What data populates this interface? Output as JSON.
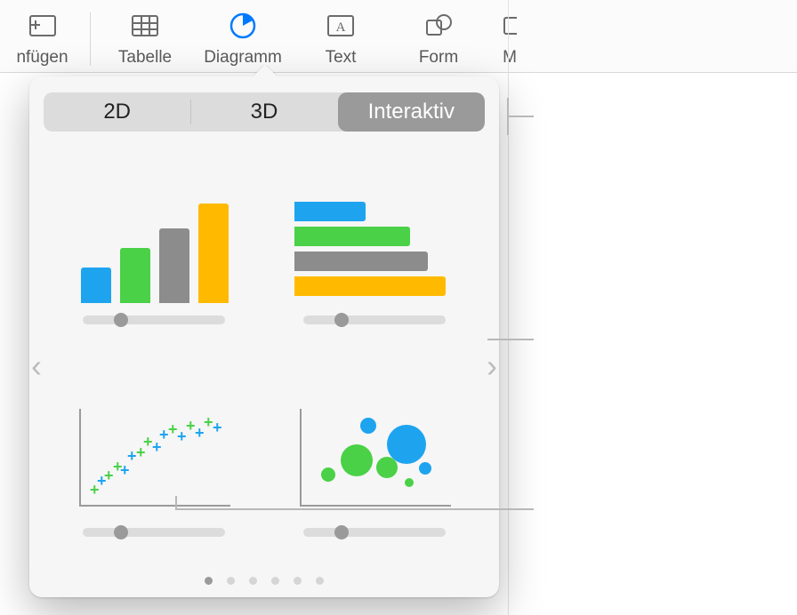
{
  "toolbar": {
    "items": [
      {
        "label": "nfügen",
        "icon": "insert"
      },
      {
        "label": "Tabelle",
        "icon": "table"
      },
      {
        "label": "Diagramm",
        "icon": "chart",
        "active": true
      },
      {
        "label": "Text",
        "icon": "text"
      },
      {
        "label": "Form",
        "icon": "shape"
      },
      {
        "label": "M",
        "icon": "more"
      }
    ]
  },
  "popover": {
    "segments": {
      "two_d": "2D",
      "three_d": "3D",
      "interactive": "Interaktiv",
      "active": "Interaktiv"
    },
    "chart_options": [
      {
        "name": "interactive-column-chart"
      },
      {
        "name": "interactive-bar-chart"
      },
      {
        "name": "interactive-scatter-chart"
      },
      {
        "name": "interactive-bubble-chart"
      }
    ],
    "page_count": 6,
    "active_page": 1,
    "colors": {
      "blue": "#1ea4ef",
      "green": "#4ad147",
      "gray": "#8c8c8c",
      "yellow": "#ffba00"
    }
  }
}
